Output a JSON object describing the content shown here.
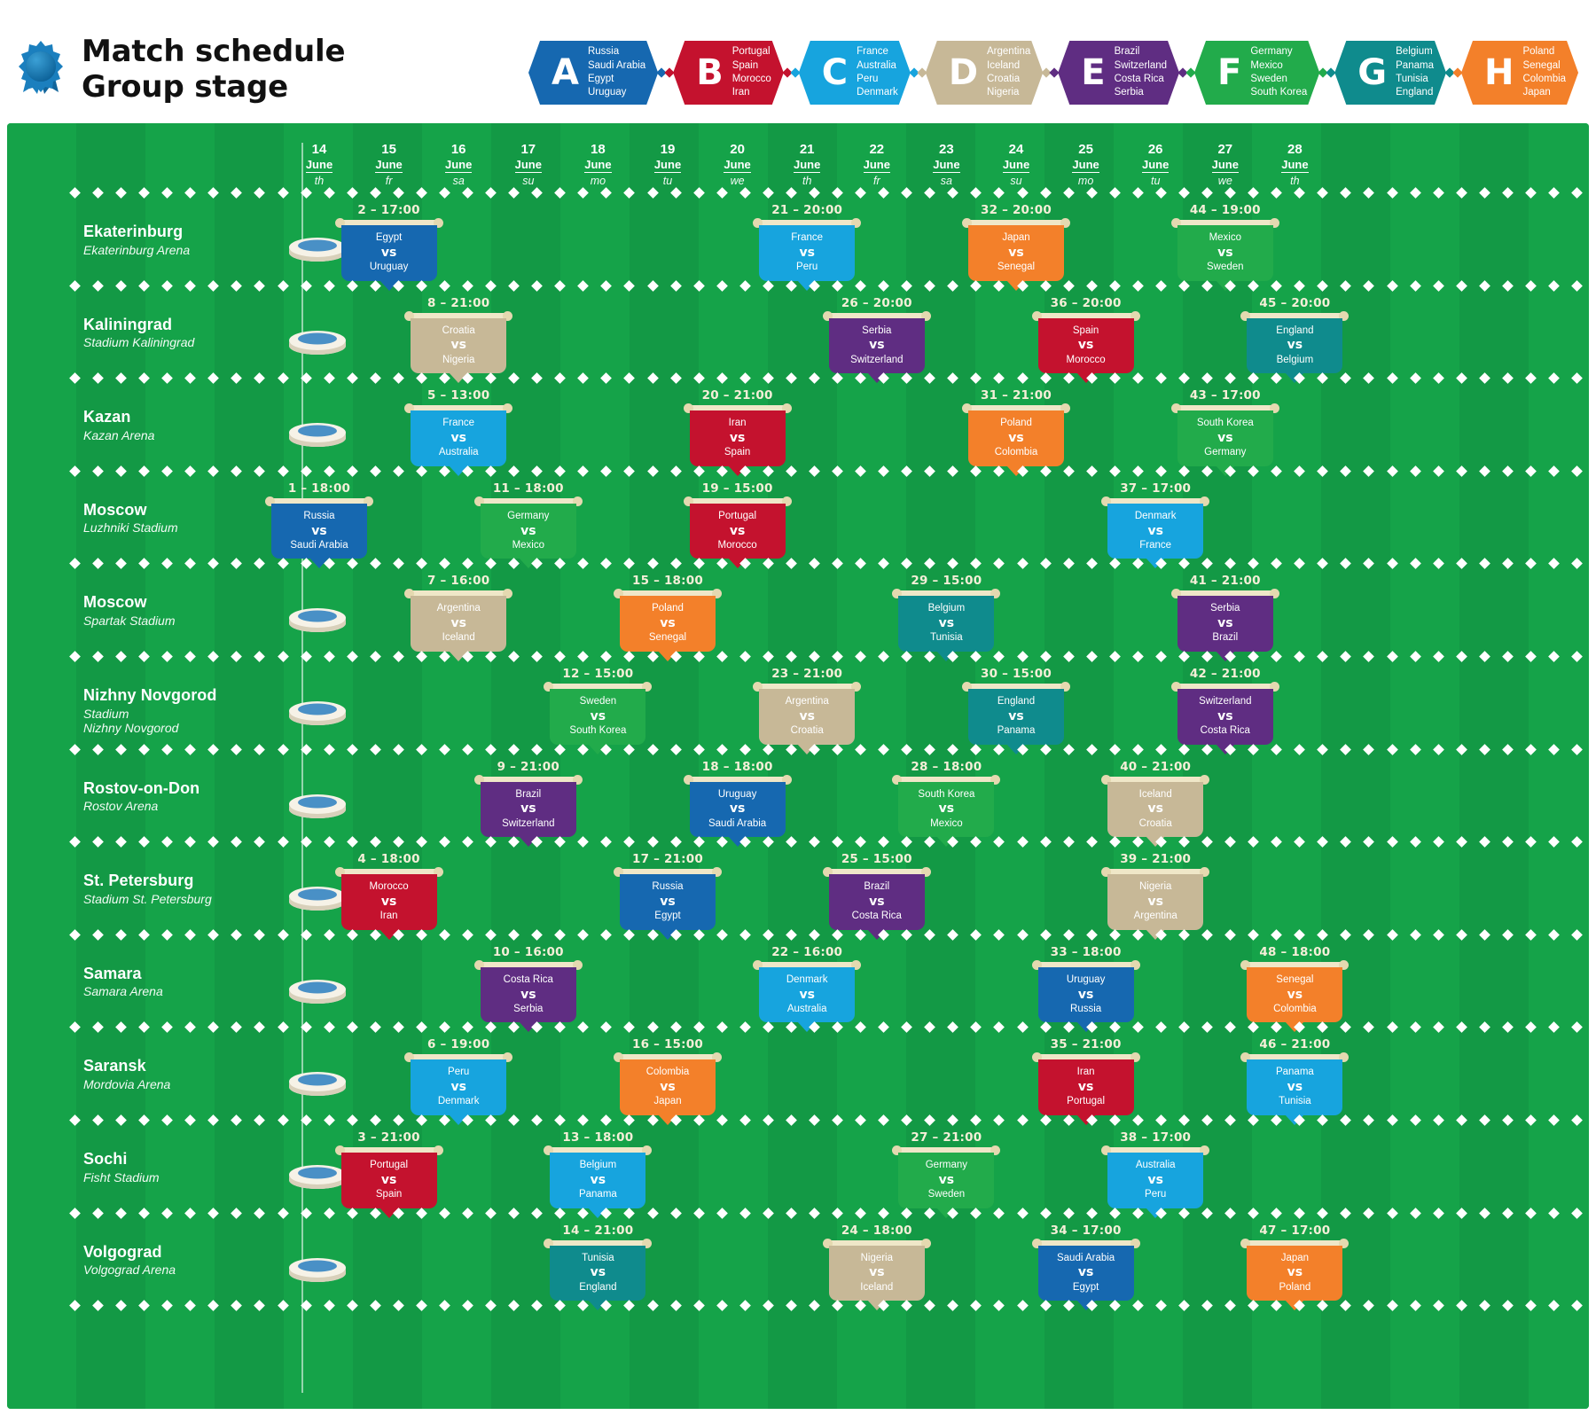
{
  "header": {
    "title_line1": "Match schedule",
    "title_line2": "Group stage",
    "rosette_icon": "rosette-icon"
  },
  "groups": [
    {
      "letter": "A",
      "color": "#1668b0",
      "teams": [
        "Russia",
        "Saudi Arabia",
        "Egypt",
        "Uruguay"
      ]
    },
    {
      "letter": "B",
      "color": "#c4122e",
      "teams": [
        "Portugal",
        "Spain",
        "Morocco",
        "Iran"
      ]
    },
    {
      "letter": "C",
      "color": "#17a4de",
      "teams": [
        "France",
        "Australia",
        "Peru",
        "Denmark"
      ]
    },
    {
      "letter": "D",
      "color": "#c7b897",
      "teams": [
        "Argentina",
        "Iceland",
        "Croatia",
        "Nigeria"
      ]
    },
    {
      "letter": "E",
      "color": "#5f2d82",
      "teams": [
        "Brazil",
        "Switzerland",
        "Costa Rica",
        "Serbia"
      ]
    },
    {
      "letter": "F",
      "color": "#22ab4b",
      "teams": [
        "Germany",
        "Mexico",
        "Sweden",
        "South Korea"
      ]
    },
    {
      "letter": "G",
      "color": "#0f8b8d",
      "teams": [
        "Belgium",
        "Panama",
        "Tunisia",
        "England"
      ]
    },
    {
      "letter": "H",
      "color": "#f3802a",
      "teams": [
        "Poland",
        "Senegal",
        "Colombia",
        "Japan"
      ]
    }
  ],
  "dates": [
    {
      "day": "14",
      "month": "June",
      "weekday": "th"
    },
    {
      "day": "15",
      "month": "June",
      "weekday": "fr"
    },
    {
      "day": "16",
      "month": "June",
      "weekday": "sa"
    },
    {
      "day": "17",
      "month": "June",
      "weekday": "su"
    },
    {
      "day": "18",
      "month": "June",
      "weekday": "mo"
    },
    {
      "day": "19",
      "month": "June",
      "weekday": "tu"
    },
    {
      "day": "20",
      "month": "June",
      "weekday": "we"
    },
    {
      "day": "21",
      "month": "June",
      "weekday": "th"
    },
    {
      "day": "22",
      "month": "June",
      "weekday": "fr"
    },
    {
      "day": "23",
      "month": "June",
      "weekday": "sa"
    },
    {
      "day": "24",
      "month": "June",
      "weekday": "su"
    },
    {
      "day": "25",
      "month": "June",
      "weekday": "mo"
    },
    {
      "day": "26",
      "month": "June",
      "weekday": "tu"
    },
    {
      "day": "27",
      "month": "June",
      "weekday": "we"
    },
    {
      "day": "28",
      "month": "June",
      "weekday": "th"
    }
  ],
  "venues": [
    {
      "city": "Ekaterinburg",
      "stadium": "Ekaterinburg Arena",
      "icon": "stadium-ekaterinburg-icon",
      "matches": [
        {
          "no": "2",
          "time": "17:00",
          "date_index": 1,
          "home": "Egypt",
          "away": "Uruguay",
          "group": "A",
          "color": "#1668b0"
        },
        {
          "no": "21",
          "time": "20:00",
          "date_index": 7,
          "home": "France",
          "away": "Peru",
          "group": "C",
          "color": "#17a4de"
        },
        {
          "no": "32",
          "time": "20:00",
          "date_index": 10,
          "home": "Japan",
          "away": "Senegal",
          "group": "H",
          "color": "#f3802a"
        },
        {
          "no": "44",
          "time": "19:00",
          "date_index": 13,
          "home": "Mexico",
          "away": "Sweden",
          "group": "F",
          "color": "#22ab4b"
        }
      ]
    },
    {
      "city": "Kaliningrad",
      "stadium": "Stadium Kaliningrad",
      "icon": "stadium-kaliningrad-icon",
      "matches": [
        {
          "no": "8",
          "time": "21:00",
          "date_index": 2,
          "home": "Croatia",
          "away": "Nigeria",
          "group": "D",
          "color": "#c7b897"
        },
        {
          "no": "26",
          "time": "20:00",
          "date_index": 8,
          "home": "Serbia",
          "away": "Switzerland",
          "group": "E",
          "color": "#5f2d82"
        },
        {
          "no": "36",
          "time": "20:00",
          "date_index": 11,
          "home": "Spain",
          "away": "Morocco",
          "group": "B",
          "color": "#c4122e"
        },
        {
          "no": "45",
          "time": "20:00",
          "date_index": 14,
          "home": "England",
          "away": "Belgium",
          "group": "G",
          "color": "#0f8b8d"
        }
      ]
    },
    {
      "city": "Kazan",
      "stadium": "Kazan Arena",
      "icon": "stadium-kazan-icon",
      "matches": [
        {
          "no": "5",
          "time": "13:00",
          "date_index": 2,
          "home": "France",
          "away": "Australia",
          "group": "C",
          "color": "#17a4de"
        },
        {
          "no": "20",
          "time": "21:00",
          "date_index": 6,
          "home": "Iran",
          "away": "Spain",
          "group": "B",
          "color": "#c4122e"
        },
        {
          "no": "31",
          "time": "21:00",
          "date_index": 10,
          "home": "Poland",
          "away": "Colombia",
          "group": "H",
          "color": "#f3802a"
        },
        {
          "no": "43",
          "time": "17:00",
          "date_index": 13,
          "home": "South Korea",
          "away": "Germany",
          "group": "F",
          "color": "#22ab4b"
        }
      ]
    },
    {
      "city": "Moscow",
      "stadium": "Luzhniki Stadium",
      "icon": "stadium-luzhniki-icon",
      "matches": [
        {
          "no": "1",
          "time": "18:00",
          "date_index": 0,
          "home": "Russia",
          "away": "Saudi Arabia",
          "group": "A",
          "color": "#1668b0"
        },
        {
          "no": "11",
          "time": "18:00",
          "date_index": 3,
          "home": "Germany",
          "away": "Mexico",
          "group": "F",
          "color": "#22ab4b"
        },
        {
          "no": "19",
          "time": "15:00",
          "date_index": 6,
          "home": "Portugal",
          "away": "Morocco",
          "group": "B",
          "color": "#c4122e"
        },
        {
          "no": "37",
          "time": "17:00",
          "date_index": 12,
          "home": "Denmark",
          "away": "France",
          "group": "C",
          "color": "#17a4de"
        }
      ]
    },
    {
      "city": "Moscow",
      "stadium": "Spartak Stadium",
      "icon": "stadium-spartak-icon",
      "matches": [
        {
          "no": "7",
          "time": "16:00",
          "date_index": 2,
          "home": "Argentina",
          "away": "Iceland",
          "group": "D",
          "color": "#c7b897"
        },
        {
          "no": "15",
          "time": "18:00",
          "date_index": 5,
          "home": "Poland",
          "away": "Senegal",
          "group": "H",
          "color": "#f3802a"
        },
        {
          "no": "29",
          "time": "15:00",
          "date_index": 9,
          "home": "Belgium",
          "away": "Tunisia",
          "group": "G",
          "color": "#0f8b8d"
        },
        {
          "no": "41",
          "time": "21:00",
          "date_index": 13,
          "home": "Serbia",
          "away": "Brazil",
          "group": "E",
          "color": "#5f2d82"
        }
      ]
    },
    {
      "city": "Nizhny Novgorod",
      "stadium": "Stadium Nizhny Novgorod",
      "icon": "stadium-nizhny-icon",
      "matches": [
        {
          "no": "12",
          "time": "15:00",
          "date_index": 4,
          "home": "Sweden",
          "away": "South Korea",
          "group": "F",
          "color": "#22ab4b"
        },
        {
          "no": "23",
          "time": "21:00",
          "date_index": 7,
          "home": "Argentina",
          "away": "Croatia",
          "group": "D",
          "color": "#c7b897"
        },
        {
          "no": "30",
          "time": "15:00",
          "date_index": 10,
          "home": "England",
          "away": "Panama",
          "group": "G",
          "color": "#0f8b8d"
        },
        {
          "no": "42",
          "time": "21:00",
          "date_index": 13,
          "home": "Switzerland",
          "away": "Costa Rica",
          "group": "E",
          "color": "#5f2d82"
        }
      ]
    },
    {
      "city": "Rostov-on-Don",
      "stadium": "Rostov Arena",
      "icon": "stadium-rostov-icon",
      "matches": [
        {
          "no": "9",
          "time": "21:00",
          "date_index": 3,
          "home": "Brazil",
          "away": "Switzerland",
          "group": "E",
          "color": "#5f2d82"
        },
        {
          "no": "18",
          "time": "18:00",
          "date_index": 6,
          "home": "Uruguay",
          "away": "Saudi Arabia",
          "group": "A",
          "color": "#1668b0"
        },
        {
          "no": "28",
          "time": "18:00",
          "date_index": 9,
          "home": "South Korea",
          "away": "Mexico",
          "group": "F",
          "color": "#22ab4b"
        },
        {
          "no": "40",
          "time": "21:00",
          "date_index": 12,
          "home": "Iceland",
          "away": "Croatia",
          "group": "D",
          "color": "#c7b897"
        }
      ]
    },
    {
      "city": "St. Petersburg",
      "stadium": "Stadium St. Petersburg",
      "icon": "stadium-spb-icon",
      "matches": [
        {
          "no": "4",
          "time": "18:00",
          "date_index": 1,
          "home": "Morocco",
          "away": "Iran",
          "group": "B",
          "color": "#c4122e"
        },
        {
          "no": "17",
          "time": "21:00",
          "date_index": 5,
          "home": "Russia",
          "away": "Egypt",
          "group": "A",
          "color": "#1668b0"
        },
        {
          "no": "25",
          "time": "15:00",
          "date_index": 8,
          "home": "Brazil",
          "away": "Costa Rica",
          "group": "E",
          "color": "#5f2d82"
        },
        {
          "no": "39",
          "time": "21:00",
          "date_index": 12,
          "home": "Nigeria",
          "away": "Argentina",
          "group": "D",
          "color": "#c7b897"
        }
      ]
    },
    {
      "city": "Samara",
      "stadium": "Samara Arena",
      "icon": "stadium-samara-icon",
      "matches": [
        {
          "no": "10",
          "time": "16:00",
          "date_index": 3,
          "home": "Costa Rica",
          "away": "Serbia",
          "group": "E",
          "color": "#5f2d82"
        },
        {
          "no": "22",
          "time": "16:00",
          "date_index": 7,
          "home": "Denmark",
          "away": "Australia",
          "group": "C",
          "color": "#17a4de"
        },
        {
          "no": "33",
          "time": "18:00",
          "date_index": 11,
          "home": "Uruguay",
          "away": "Russia",
          "group": "A",
          "color": "#1668b0"
        },
        {
          "no": "48",
          "time": "18:00",
          "date_index": 14,
          "home": "Senegal",
          "away": "Colombia",
          "group": "H",
          "color": "#f3802a"
        }
      ]
    },
    {
      "city": "Saransk",
      "stadium": "Mordovia Arena",
      "icon": "stadium-saransk-icon",
      "matches": [
        {
          "no": "6",
          "time": "19:00",
          "date_index": 2,
          "home": "Peru",
          "away": "Denmark",
          "group": "C",
          "color": "#17a4de"
        },
        {
          "no": "16",
          "time": "15:00",
          "date_index": 5,
          "home": "Colombia",
          "away": "Japan",
          "group": "H",
          "color": "#f3802a"
        },
        {
          "no": "35",
          "time": "21:00",
          "date_index": 11,
          "home": "Iran",
          "away": "Portugal",
          "group": "B",
          "color": "#c4122e"
        },
        {
          "no": "46",
          "time": "21:00",
          "date_index": 14,
          "home": "Panama",
          "away": "Tunisia",
          "group": "G",
          "color": "#17a4de"
        }
      ]
    },
    {
      "city": "Sochi",
      "stadium": "Fisht Stadium",
      "icon": "stadium-sochi-icon",
      "matches": [
        {
          "no": "3",
          "time": "21:00",
          "date_index": 1,
          "home": "Portugal",
          "away": "Spain",
          "group": "B",
          "color": "#c4122e"
        },
        {
          "no": "13",
          "time": "18:00",
          "date_index": 4,
          "home": "Belgium",
          "away": "Panama",
          "group": "G",
          "color": "#17a4de"
        },
        {
          "no": "27",
          "time": "21:00",
          "date_index": 9,
          "home": "Germany",
          "away": "Sweden",
          "group": "F",
          "color": "#22ab4b"
        },
        {
          "no": "38",
          "time": "17:00",
          "date_index": 12,
          "home": "Australia",
          "away": "Peru",
          "group": "C",
          "color": "#17a4de"
        }
      ]
    },
    {
      "city": "Volgograd",
      "stadium": "Volgograd Arena",
      "icon": "stadium-volgograd-icon",
      "matches": [
        {
          "no": "14",
          "time": "21:00",
          "date_index": 4,
          "home": "Tunisia",
          "away": "England",
          "group": "G",
          "color": "#0f8b8d"
        },
        {
          "no": "24",
          "time": "18:00",
          "date_index": 8,
          "home": "Nigeria",
          "away": "Iceland",
          "group": "D",
          "color": "#c7b897"
        },
        {
          "no": "34",
          "time": "17:00",
          "date_index": 11,
          "home": "Saudi Arabia",
          "away": "Egypt",
          "group": "A",
          "color": "#1668b0"
        },
        {
          "no": "47",
          "time": "17:00",
          "date_index": 14,
          "home": "Japan",
          "away": "Poland",
          "group": "H",
          "color": "#f3802a"
        }
      ]
    }
  ],
  "vs_label": "vs",
  "colors": {
    "pitch": "#15a349",
    "pitch_stripe": "#139945",
    "card_bar": "#efe7c8",
    "time_text": "#f5efd8"
  }
}
